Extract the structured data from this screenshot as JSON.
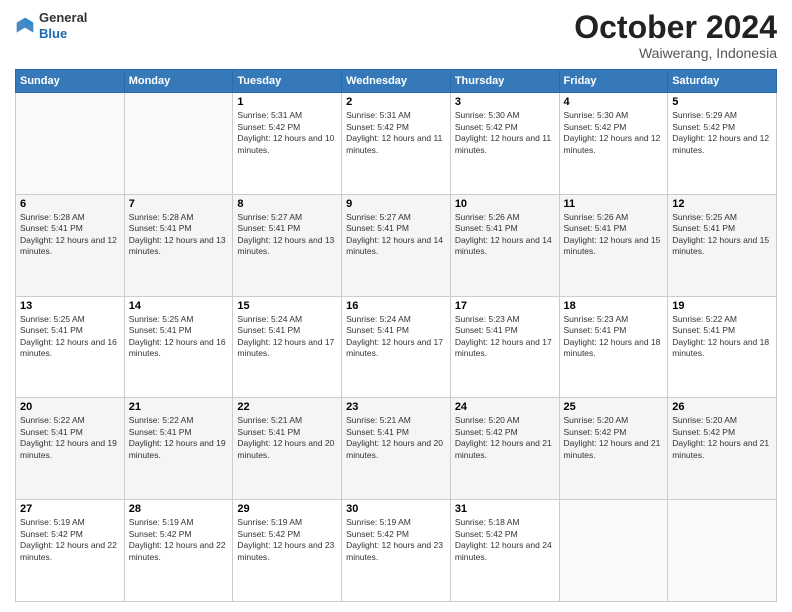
{
  "logo": {
    "general": "General",
    "blue": "Blue"
  },
  "header": {
    "month": "October 2024",
    "location": "Waiwerang, Indonesia"
  },
  "days_of_week": [
    "Sunday",
    "Monday",
    "Tuesday",
    "Wednesday",
    "Thursday",
    "Friday",
    "Saturday"
  ],
  "weeks": [
    [
      {
        "day": "",
        "sunrise": "",
        "sunset": "",
        "daylight": ""
      },
      {
        "day": "",
        "sunrise": "",
        "sunset": "",
        "daylight": ""
      },
      {
        "day": "1",
        "sunrise": "Sunrise: 5:31 AM",
        "sunset": "Sunset: 5:42 PM",
        "daylight": "Daylight: 12 hours and 10 minutes."
      },
      {
        "day": "2",
        "sunrise": "Sunrise: 5:31 AM",
        "sunset": "Sunset: 5:42 PM",
        "daylight": "Daylight: 12 hours and 11 minutes."
      },
      {
        "day": "3",
        "sunrise": "Sunrise: 5:30 AM",
        "sunset": "Sunset: 5:42 PM",
        "daylight": "Daylight: 12 hours and 11 minutes."
      },
      {
        "day": "4",
        "sunrise": "Sunrise: 5:30 AM",
        "sunset": "Sunset: 5:42 PM",
        "daylight": "Daylight: 12 hours and 12 minutes."
      },
      {
        "day": "5",
        "sunrise": "Sunrise: 5:29 AM",
        "sunset": "Sunset: 5:42 PM",
        "daylight": "Daylight: 12 hours and 12 minutes."
      }
    ],
    [
      {
        "day": "6",
        "sunrise": "Sunrise: 5:28 AM",
        "sunset": "Sunset: 5:41 PM",
        "daylight": "Daylight: 12 hours and 12 minutes."
      },
      {
        "day": "7",
        "sunrise": "Sunrise: 5:28 AM",
        "sunset": "Sunset: 5:41 PM",
        "daylight": "Daylight: 12 hours and 13 minutes."
      },
      {
        "day": "8",
        "sunrise": "Sunrise: 5:27 AM",
        "sunset": "Sunset: 5:41 PM",
        "daylight": "Daylight: 12 hours and 13 minutes."
      },
      {
        "day": "9",
        "sunrise": "Sunrise: 5:27 AM",
        "sunset": "Sunset: 5:41 PM",
        "daylight": "Daylight: 12 hours and 14 minutes."
      },
      {
        "day": "10",
        "sunrise": "Sunrise: 5:26 AM",
        "sunset": "Sunset: 5:41 PM",
        "daylight": "Daylight: 12 hours and 14 minutes."
      },
      {
        "day": "11",
        "sunrise": "Sunrise: 5:26 AM",
        "sunset": "Sunset: 5:41 PM",
        "daylight": "Daylight: 12 hours and 15 minutes."
      },
      {
        "day": "12",
        "sunrise": "Sunrise: 5:25 AM",
        "sunset": "Sunset: 5:41 PM",
        "daylight": "Daylight: 12 hours and 15 minutes."
      }
    ],
    [
      {
        "day": "13",
        "sunrise": "Sunrise: 5:25 AM",
        "sunset": "Sunset: 5:41 PM",
        "daylight": "Daylight: 12 hours and 16 minutes."
      },
      {
        "day": "14",
        "sunrise": "Sunrise: 5:25 AM",
        "sunset": "Sunset: 5:41 PM",
        "daylight": "Daylight: 12 hours and 16 minutes."
      },
      {
        "day": "15",
        "sunrise": "Sunrise: 5:24 AM",
        "sunset": "Sunset: 5:41 PM",
        "daylight": "Daylight: 12 hours and 17 minutes."
      },
      {
        "day": "16",
        "sunrise": "Sunrise: 5:24 AM",
        "sunset": "Sunset: 5:41 PM",
        "daylight": "Daylight: 12 hours and 17 minutes."
      },
      {
        "day": "17",
        "sunrise": "Sunrise: 5:23 AM",
        "sunset": "Sunset: 5:41 PM",
        "daylight": "Daylight: 12 hours and 17 minutes."
      },
      {
        "day": "18",
        "sunrise": "Sunrise: 5:23 AM",
        "sunset": "Sunset: 5:41 PM",
        "daylight": "Daylight: 12 hours and 18 minutes."
      },
      {
        "day": "19",
        "sunrise": "Sunrise: 5:22 AM",
        "sunset": "Sunset: 5:41 PM",
        "daylight": "Daylight: 12 hours and 18 minutes."
      }
    ],
    [
      {
        "day": "20",
        "sunrise": "Sunrise: 5:22 AM",
        "sunset": "Sunset: 5:41 PM",
        "daylight": "Daylight: 12 hours and 19 minutes."
      },
      {
        "day": "21",
        "sunrise": "Sunrise: 5:22 AM",
        "sunset": "Sunset: 5:41 PM",
        "daylight": "Daylight: 12 hours and 19 minutes."
      },
      {
        "day": "22",
        "sunrise": "Sunrise: 5:21 AM",
        "sunset": "Sunset: 5:41 PM",
        "daylight": "Daylight: 12 hours and 20 minutes."
      },
      {
        "day": "23",
        "sunrise": "Sunrise: 5:21 AM",
        "sunset": "Sunset: 5:41 PM",
        "daylight": "Daylight: 12 hours and 20 minutes."
      },
      {
        "day": "24",
        "sunrise": "Sunrise: 5:20 AM",
        "sunset": "Sunset: 5:42 PM",
        "daylight": "Daylight: 12 hours and 21 minutes."
      },
      {
        "day": "25",
        "sunrise": "Sunrise: 5:20 AM",
        "sunset": "Sunset: 5:42 PM",
        "daylight": "Daylight: 12 hours and 21 minutes."
      },
      {
        "day": "26",
        "sunrise": "Sunrise: 5:20 AM",
        "sunset": "Sunset: 5:42 PM",
        "daylight": "Daylight: 12 hours and 21 minutes."
      }
    ],
    [
      {
        "day": "27",
        "sunrise": "Sunrise: 5:19 AM",
        "sunset": "Sunset: 5:42 PM",
        "daylight": "Daylight: 12 hours and 22 minutes."
      },
      {
        "day": "28",
        "sunrise": "Sunrise: 5:19 AM",
        "sunset": "Sunset: 5:42 PM",
        "daylight": "Daylight: 12 hours and 22 minutes."
      },
      {
        "day": "29",
        "sunrise": "Sunrise: 5:19 AM",
        "sunset": "Sunset: 5:42 PM",
        "daylight": "Daylight: 12 hours and 23 minutes."
      },
      {
        "day": "30",
        "sunrise": "Sunrise: 5:19 AM",
        "sunset": "Sunset: 5:42 PM",
        "daylight": "Daylight: 12 hours and 23 minutes."
      },
      {
        "day": "31",
        "sunrise": "Sunrise: 5:18 AM",
        "sunset": "Sunset: 5:42 PM",
        "daylight": "Daylight: 12 hours and 24 minutes."
      },
      {
        "day": "",
        "sunrise": "",
        "sunset": "",
        "daylight": ""
      },
      {
        "day": "",
        "sunrise": "",
        "sunset": "",
        "daylight": ""
      }
    ]
  ]
}
